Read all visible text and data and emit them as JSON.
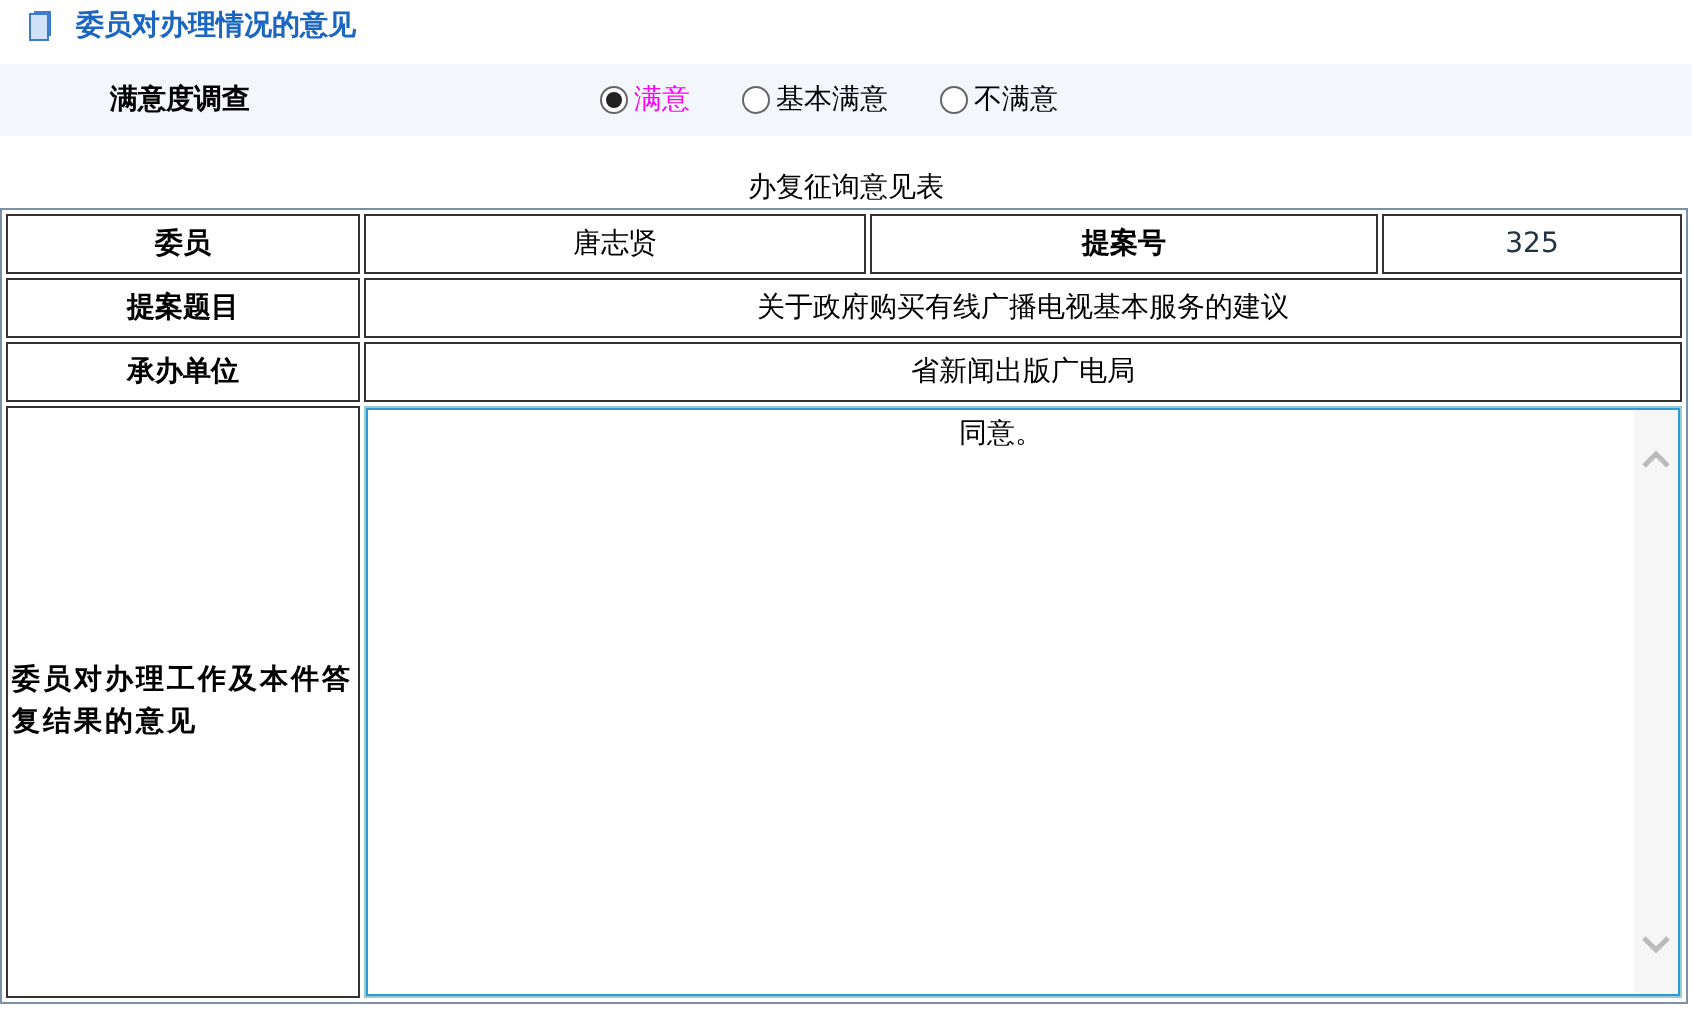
{
  "section_title": "委员对办理情况的意见",
  "survey": {
    "label": "满意度调查",
    "options": [
      {
        "label": "满意",
        "selected": true
      },
      {
        "label": "基本满意",
        "selected": false
      },
      {
        "label": "不满意",
        "selected": false
      }
    ]
  },
  "form": {
    "caption": "办复征询意见表",
    "member_label": "委员",
    "member": "唐志贤",
    "proposal_no_label": "提案号",
    "proposal_no": "325",
    "subject_label": "提案题目",
    "subject": "关于政府购买有线广播电视基本服务的建议",
    "unit_label": "承办单位",
    "unit": "省新闻出版广电局",
    "opinion_label": "委员对办理工作及本件答复结果的意见",
    "opinion": "同意。"
  }
}
